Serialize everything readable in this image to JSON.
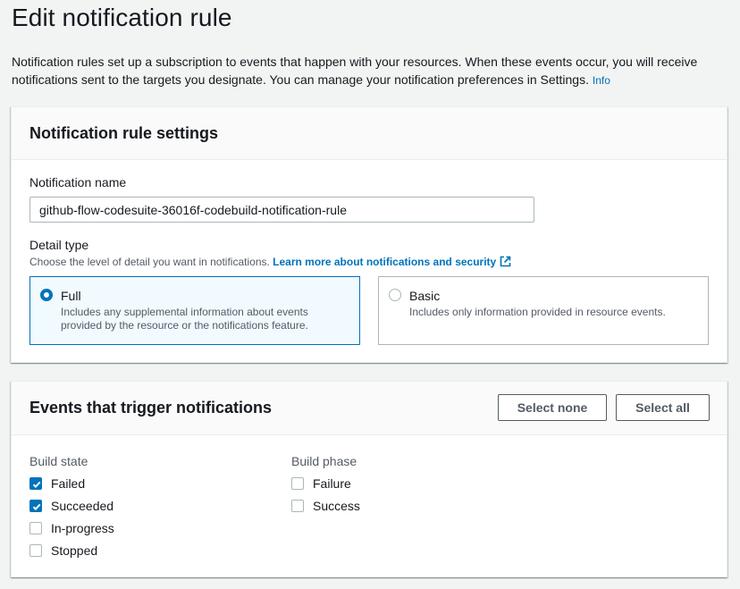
{
  "page": {
    "title": "Edit notification rule",
    "description": "Notification rules set up a subscription to events that happen with your resources. When these events occur, you will receive notifications sent to the targets you designate. You can manage your notification preferences in Settings.",
    "info_link": "Info"
  },
  "settings": {
    "title": "Notification rule settings",
    "name_label": "Notification name",
    "name_value": "github-flow-codesuite-36016f-codebuild-notification-rule",
    "detail_label": "Detail type",
    "detail_desc": "Choose the level of detail you want in notifications.",
    "detail_link": "Learn more about notifications and security",
    "options": [
      {
        "title": "Full",
        "desc": "Includes any supplemental information about events provided by the resource or the notifications feature.",
        "selected": true
      },
      {
        "title": "Basic",
        "desc": "Includes only information provided in resource events.",
        "selected": false
      }
    ]
  },
  "events": {
    "title": "Events that trigger notifications",
    "select_none_label": "Select none",
    "select_all_label": "Select all",
    "groups": [
      {
        "title": "Build state",
        "items": [
          {
            "label": "Failed",
            "checked": true
          },
          {
            "label": "Succeeded",
            "checked": true
          },
          {
            "label": "In-progress",
            "checked": false
          },
          {
            "label": "Stopped",
            "checked": false
          }
        ]
      },
      {
        "title": "Build phase",
        "items": [
          {
            "label": "Failure",
            "checked": false
          },
          {
            "label": "Success",
            "checked": false
          }
        ]
      }
    ]
  },
  "colors": {
    "accent": "#0073bb",
    "text": "#16191f",
    "muted": "#545b64"
  },
  "icons": {
    "external_link": "external-link-icon",
    "checkmark": "checkmark-icon"
  }
}
